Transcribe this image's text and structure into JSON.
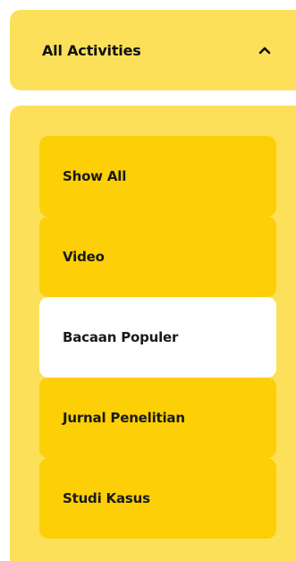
{
  "dropdown": {
    "title": "All Activities",
    "expanded_icon": "chevron-up-icon"
  },
  "menu": {
    "items": [
      {
        "label": "Show All",
        "active": false
      },
      {
        "label": "Video",
        "active": false
      },
      {
        "label": "Bacaan Populer",
        "active": true
      },
      {
        "label": "Jurnal Penelitian",
        "active": false
      },
      {
        "label": "Studi Kasus",
        "active": false
      }
    ]
  },
  "colors": {
    "panel_background": "#fde05a",
    "item_background": "#fccf06",
    "active_item_background": "#ffffff",
    "text": "#111111"
  }
}
